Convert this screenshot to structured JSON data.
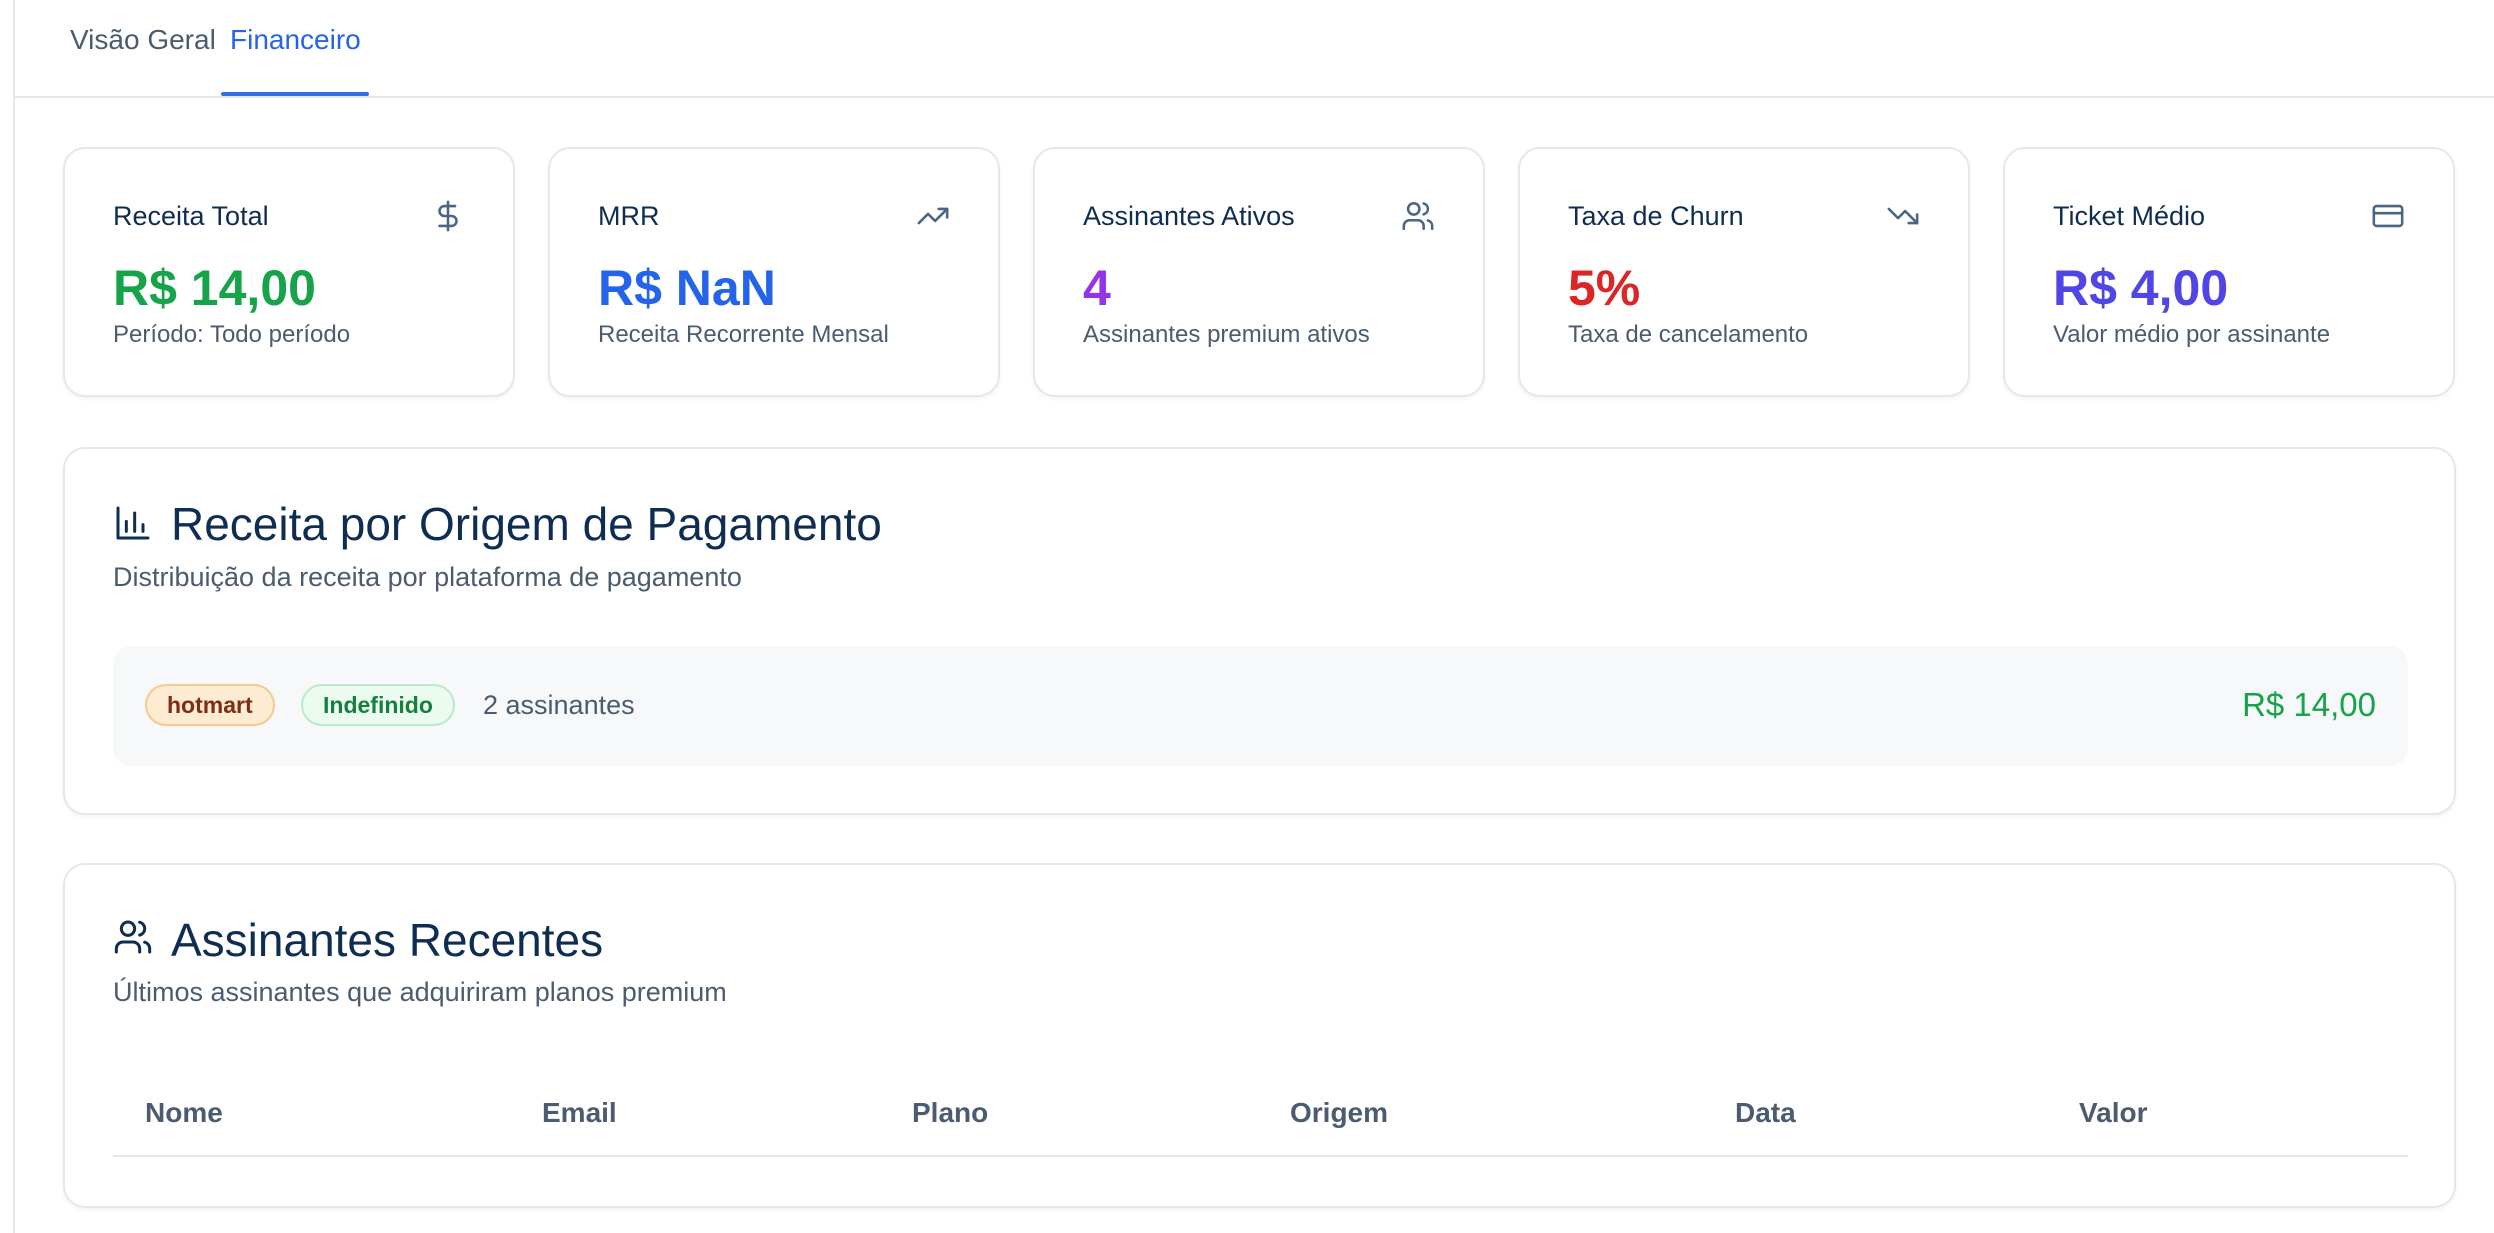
{
  "tabs": [
    {
      "label": "Visão Geral",
      "active": false
    },
    {
      "label": "Financeiro",
      "active": true
    }
  ],
  "stats": [
    {
      "title": "Receita Total",
      "value": "R$ 14,00",
      "description": "Período: Todo período",
      "icon": "dollar-icon",
      "color": "#16a34a"
    },
    {
      "title": "MRR",
      "value": "R$ NaN",
      "description": "Receita Recorrente Mensal",
      "icon": "trending-up-icon",
      "color": "#2563eb"
    },
    {
      "title": "Assinantes Ativos",
      "value": "4",
      "description": "Assinantes premium ativos",
      "icon": "users-icon",
      "color": "#9333ea"
    },
    {
      "title": "Taxa de Churn",
      "value": "5%",
      "description": "Taxa de cancelamento",
      "icon": "trending-down-icon",
      "color": "#dc2626"
    },
    {
      "title": "Ticket Médio",
      "value": "R$ 4,00",
      "description": "Valor médio por assinante",
      "icon": "credit-card-icon",
      "color": "#4f46e5"
    }
  ],
  "revenue_by_origin": {
    "title": "Receita por Origem de Pagamento",
    "subtitle": "Distribuição da receita por plataforma de pagamento",
    "icon": "bar-chart-icon",
    "rows": [
      {
        "badges": [
          "hotmart",
          "Indefinido"
        ],
        "count": "2 assinantes",
        "value": "R$ 14,00"
      }
    ]
  },
  "recent_subscribers": {
    "title": "Assinantes Recentes",
    "subtitle": "Últimos assinantes que adquiriram planos premium",
    "icon": "users-icon",
    "columns": [
      "Nome",
      "Email",
      "Plano",
      "Origem",
      "Data",
      "Valor"
    ]
  }
}
